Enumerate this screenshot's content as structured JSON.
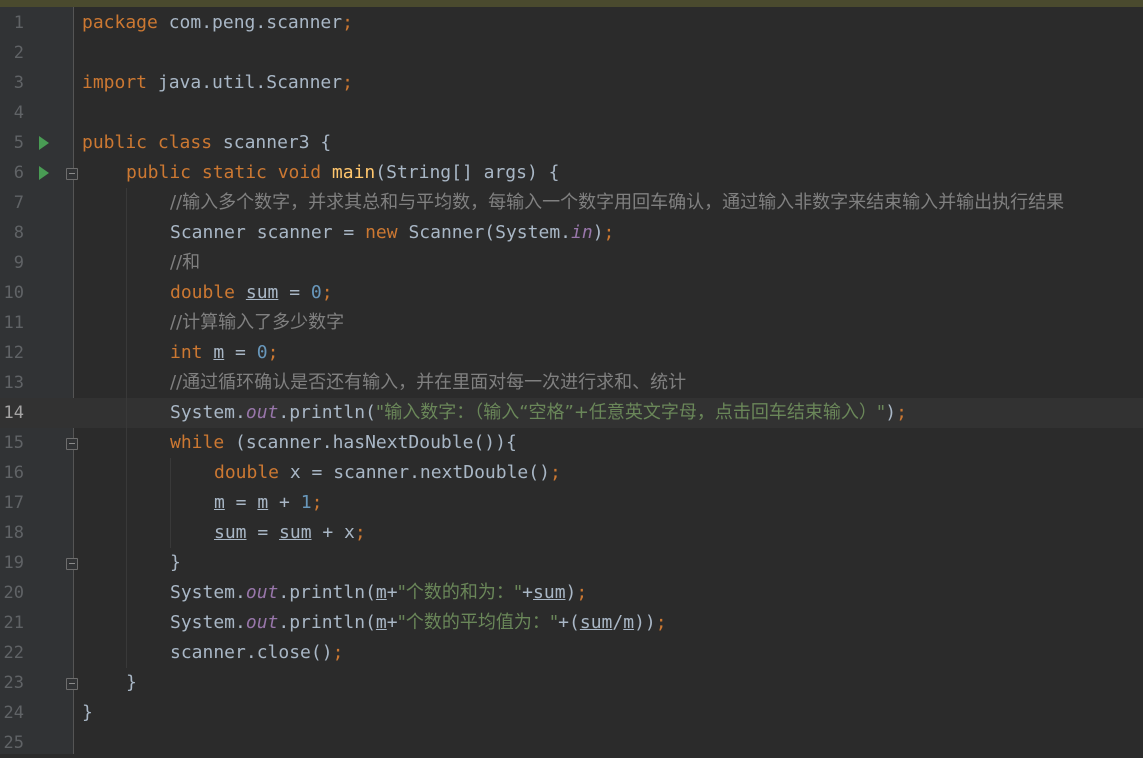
{
  "editor": {
    "current_line": 14,
    "lines": [
      {
        "n": "1",
        "indent": 0,
        "tokens": [
          {
            "t": "package ",
            "c": "kw"
          },
          {
            "t": "com.peng.scanner"
          },
          {
            "t": ";",
            "c": "kw"
          }
        ]
      },
      {
        "n": "2",
        "indent": 0,
        "tokens": []
      },
      {
        "n": "3",
        "indent": 0,
        "tokens": [
          {
            "t": "import ",
            "c": "kw"
          },
          {
            "t": "java.util.Scanner"
          },
          {
            "t": ";",
            "c": "kw"
          }
        ]
      },
      {
        "n": "4",
        "indent": 0,
        "tokens": []
      },
      {
        "n": "5",
        "indent": 0,
        "run": true,
        "tokens": [
          {
            "t": "public class ",
            "c": "kw"
          },
          {
            "t": "scanner3 {"
          }
        ]
      },
      {
        "n": "6",
        "indent": 1,
        "run": true,
        "fold": true,
        "tokens": [
          {
            "t": "public static void ",
            "c": "kw"
          },
          {
            "t": "main",
            "c": "fn"
          },
          {
            "t": "(String[] args) {"
          }
        ]
      },
      {
        "n": "7",
        "indent": 2,
        "tokens": [
          {
            "t": "//输入多个数字，并求其总和与平均数，每输入一个数字用回车确认，通过输入非数字来结束输入并输出执行结果",
            "c": "cmt"
          }
        ]
      },
      {
        "n": "8",
        "indent": 2,
        "tokens": [
          {
            "t": "Scanner scanner = "
          },
          {
            "t": "new ",
            "c": "kw"
          },
          {
            "t": "Scanner(System."
          },
          {
            "t": "in",
            "c": "sf"
          },
          {
            "t": ")"
          },
          {
            "t": ";",
            "c": "kw"
          }
        ]
      },
      {
        "n": "9",
        "indent": 2,
        "tokens": [
          {
            "t": "//和",
            "c": "cmt"
          }
        ]
      },
      {
        "n": "10",
        "indent": 2,
        "tokens": [
          {
            "t": "double ",
            "c": "kw"
          },
          {
            "t": "sum",
            "c": "lv"
          },
          {
            "t": " = "
          },
          {
            "t": "0",
            "c": "num"
          },
          {
            "t": ";",
            "c": "kw"
          }
        ]
      },
      {
        "n": "11",
        "indent": 2,
        "tokens": [
          {
            "t": "//计算输入了多少数字",
            "c": "cmt"
          }
        ]
      },
      {
        "n": "12",
        "indent": 2,
        "tokens": [
          {
            "t": "int ",
            "c": "kw"
          },
          {
            "t": "m",
            "c": "lv"
          },
          {
            "t": " = "
          },
          {
            "t": "0",
            "c": "num"
          },
          {
            "t": ";",
            "c": "kw"
          }
        ]
      },
      {
        "n": "13",
        "indent": 2,
        "tokens": [
          {
            "t": "//通过循环确认是否还有输入，并在里面对每一次进行求和、统计",
            "c": "cmt"
          }
        ]
      },
      {
        "n": "14",
        "indent": 2,
        "tokens": [
          {
            "t": "System."
          },
          {
            "t": "out",
            "c": "sf"
          },
          {
            "t": ".println("
          },
          {
            "t": "\"输入数字：（输入“空格”+任意英文字母，点击回车结束输入）\"",
            "c": "str"
          },
          {
            "t": ")"
          },
          {
            "t": ";",
            "c": "kw"
          }
        ]
      },
      {
        "n": "15",
        "indent": 2,
        "fold": true,
        "tokens": [
          {
            "t": "while ",
            "c": "kw"
          },
          {
            "t": "(scanner.hasNextDouble()){"
          }
        ]
      },
      {
        "n": "16",
        "indent": 3,
        "tokens": [
          {
            "t": "double ",
            "c": "kw"
          },
          {
            "t": "x = scanner.nextDouble()"
          },
          {
            "t": ";",
            "c": "kw"
          }
        ]
      },
      {
        "n": "17",
        "indent": 3,
        "tokens": [
          {
            "t": "m",
            "c": "lv"
          },
          {
            "t": " = "
          },
          {
            "t": "m",
            "c": "lv"
          },
          {
            "t": " + "
          },
          {
            "t": "1",
            "c": "num"
          },
          {
            "t": ";",
            "c": "kw"
          }
        ]
      },
      {
        "n": "18",
        "indent": 3,
        "tokens": [
          {
            "t": "sum",
            "c": "lv"
          },
          {
            "t": " = "
          },
          {
            "t": "sum",
            "c": "lv"
          },
          {
            "t": " + x"
          },
          {
            "t": ";",
            "c": "kw"
          }
        ]
      },
      {
        "n": "19",
        "indent": 2,
        "fold": true,
        "tokens": [
          {
            "t": "}"
          }
        ]
      },
      {
        "n": "20",
        "indent": 2,
        "tokens": [
          {
            "t": "System."
          },
          {
            "t": "out",
            "c": "sf"
          },
          {
            "t": ".println("
          },
          {
            "t": "m",
            "c": "lv"
          },
          {
            "t": "+"
          },
          {
            "t": "\"个数的和为：\"",
            "c": "str"
          },
          {
            "t": "+"
          },
          {
            "t": "sum",
            "c": "lv"
          },
          {
            "t": ")"
          },
          {
            "t": ";",
            "c": "kw"
          }
        ]
      },
      {
        "n": "21",
        "indent": 2,
        "tokens": [
          {
            "t": "System."
          },
          {
            "t": "out",
            "c": "sf"
          },
          {
            "t": ".println("
          },
          {
            "t": "m",
            "c": "lv"
          },
          {
            "t": "+"
          },
          {
            "t": "\"个数的平均值为：\"",
            "c": "str"
          },
          {
            "t": "+("
          },
          {
            "t": "sum",
            "c": "lv"
          },
          {
            "t": "/"
          },
          {
            "t": "m",
            "c": "lv"
          },
          {
            "t": "))"
          },
          {
            "t": ";",
            "c": "kw"
          }
        ]
      },
      {
        "n": "22",
        "indent": 2,
        "tokens": [
          {
            "t": "scanner.close()"
          },
          {
            "t": ";",
            "c": "kw"
          }
        ]
      },
      {
        "n": "23",
        "indent": 1,
        "fold": true,
        "tokens": [
          {
            "t": "}"
          }
        ]
      },
      {
        "n": "24",
        "indent": 0,
        "tokens": [
          {
            "t": "}"
          }
        ]
      },
      {
        "n": "25",
        "indent": 0,
        "tokens": []
      }
    ]
  }
}
